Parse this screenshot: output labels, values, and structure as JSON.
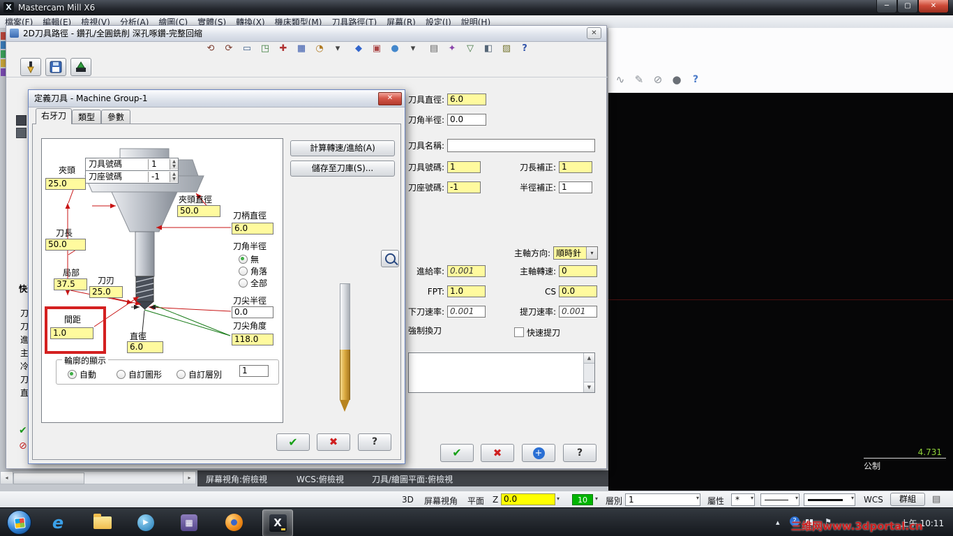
{
  "titlebar": {
    "title": "Mastercam Mill X6",
    "min": "─",
    "max": "▢",
    "close": "✕"
  },
  "menubar": {
    "items": [
      "檔案(F)",
      "編輯(E)",
      "檢視(V)",
      "分析(A)",
      "繪圖(C)",
      "實體(S)",
      "轉換(X)",
      "機床類型(M)",
      "刀具路徑(T)",
      "屏幕(R)",
      "設定(I)",
      "說明(H)"
    ]
  },
  "main_toolbar_right": {
    "icons": [
      {
        "name": "wave",
        "g": "∿",
        "c": "#8a8f96"
      },
      {
        "name": "edit",
        "g": "✎",
        "c": "#8a8f96"
      },
      {
        "name": "no-entry",
        "g": "⊘",
        "c": "#8a8f96"
      },
      {
        "name": "circle",
        "g": "●",
        "c": "#6a6f76"
      },
      {
        "name": "help",
        "g": "?",
        "c": "#4a7ac8"
      }
    ]
  },
  "toolpath_dialog": {
    "title": "2D刀具路徑 - 鑽孔/全圓銑削 深孔啄鑽-完整回縮",
    "close": "✕",
    "icons": [
      {
        "name": "undo",
        "g": "⟲",
        "c": "#7a3b2e"
      },
      {
        "name": "redo",
        "g": "⟳",
        "c": "#7a3b2e"
      },
      {
        "name": "rect",
        "g": "▭",
        "c": "#44658f"
      },
      {
        "name": "corner",
        "g": "◳",
        "c": "#3c7d3c"
      },
      {
        "name": "plus",
        "g": "✚",
        "c": "#b03333"
      },
      {
        "name": "grid",
        "g": "▦",
        "c": "#3355aa"
      },
      {
        "name": "pie",
        "g": "◔",
        "c": "#b07a22"
      },
      {
        "name": "drop1",
        "g": "▾",
        "c": "#444444"
      },
      {
        "name": "diamond",
        "g": "◆",
        "c": "#3366cc"
      },
      {
        "name": "sq-red",
        "g": "▣",
        "c": "#aa4444"
      },
      {
        "name": "dot-blue",
        "g": "●",
        "c": "#4488cc"
      },
      {
        "name": "drop2",
        "g": "▾",
        "c": "#444444"
      },
      {
        "name": "rows",
        "g": "▤",
        "c": "#6a6a6a"
      },
      {
        "name": "star",
        "g": "✦",
        "c": "#8a44aa"
      },
      {
        "name": "tri",
        "g": "▽",
        "c": "#447744"
      },
      {
        "name": "half",
        "g": "◧",
        "c": "#556677"
      },
      {
        "name": "hatch",
        "g": "▨",
        "c": "#777733"
      },
      {
        "name": "help",
        "g": "?",
        "c": "#3355aa"
      }
    ],
    "quick_view": {
      "header": "快速",
      "items": [
        "刀",
        "刀",
        "進",
        "主",
        "冷",
        "刀",
        "直"
      ],
      "ok": "✔",
      "no": "⊘"
    },
    "params": {
      "tool_dia_label": "刀具直徑:",
      "tool_dia": "6.0",
      "corner_label": "刀角半徑:",
      "corner": "0.0",
      "name_label": "刀具名稱:",
      "name": "",
      "tool_no_label": "刀具號碼:",
      "tool_no": "1",
      "len_off_label": "刀長補正:",
      "len_off": "1",
      "holder_no_label": "刀座號碼:",
      "holder_no": "-1",
      "rad_off_label": "半徑補正:",
      "rad_off": "1",
      "spindle_dir_label": "主軸方向:",
      "spindle_dir": "順時針",
      "feed_label": "進給率:",
      "feed": "0.001",
      "spindle_label": "主軸轉速:",
      "spindle": "0",
      "fpt_label": "FPT:",
      "fpt": "1.0",
      "cs_label": "CS",
      "cs": "0.0",
      "plunge_label": "下刀速率:",
      "plunge": "0.001",
      "retract_label": "提刀速率:",
      "retract": "0.001",
      "force_label": "強制換刀",
      "quick_retract_label": "快速提刀",
      "ok": "✔",
      "cancel": "✖",
      "plus": "+",
      "help": "?"
    }
  },
  "tool_dialog": {
    "title": "定義刀具 - Machine Group-1",
    "close": "✕",
    "tabs": [
      "右牙刀",
      "類型",
      "參數"
    ],
    "buttons": {
      "calc": "計算轉速/進給(A)",
      "save": "儲存至刀庫(S)...",
      "ok": "✔",
      "cancel": "✖",
      "help": "?"
    },
    "diagram": {
      "tool_no_label": "刀具號碼",
      "tool_no": "1",
      "holder_no_label": "刀座號碼",
      "holder_no": "-1",
      "chuck_label": "夾頭",
      "chuck": "25.0",
      "chuck_dia_label": "夾頭直徑",
      "chuck_dia": "50.0",
      "shank_dia_label": "刀柄直徑",
      "shank_dia": "6.0",
      "length_label": "刀長",
      "length": "50.0",
      "corner_label": "刀角半徑",
      "corner_none": "無",
      "corner_corner": "角落",
      "corner_full": "全部",
      "partial_label": "局部",
      "partial": "37.5",
      "flute_label": "刀刃",
      "flute": "25.0",
      "tip_r_label": "刀尖半徑",
      "tip_r": "0.0",
      "pitch_label": "間距",
      "pitch": "1.0",
      "dia_label": "直徑",
      "dia": "6.0",
      "tip_a_label": "刀尖角度",
      "tip_a": "118.0"
    },
    "profile": {
      "label": "輪廓的顯示",
      "auto": "自動",
      "custom_geo": "自訂圖形",
      "custom_level": "自訂層別",
      "level": "1"
    }
  },
  "status_bar": {
    "view": "屏幕視角:俯檢視",
    "wcs": "WCS:俯檢視",
    "plane": "刀具/繪圖平面:俯檢視"
  },
  "bottom_bar": {
    "b3d": "3D",
    "screen_view": "屏幕視角",
    "plane": "平面",
    "z": "Z",
    "z_val": "0.0",
    "color": "10",
    "level_label": "層別",
    "level": "1",
    "attr": "屬性",
    "star": "*",
    "wcs": "WCS",
    "group": "群組"
  },
  "viewport": {
    "coord": "4.731",
    "units": "公制"
  },
  "taskbar": {
    "time": "上午 10:11",
    "watermark": "三维网www.3dportal.cn"
  }
}
